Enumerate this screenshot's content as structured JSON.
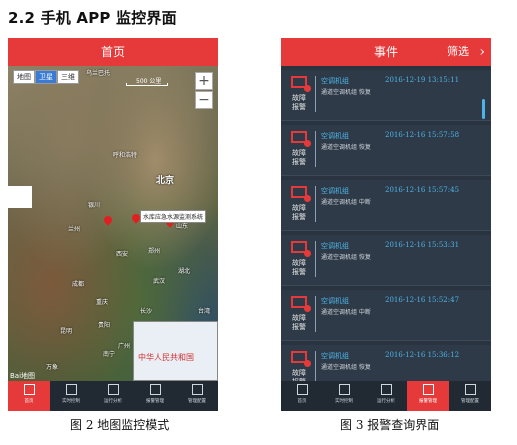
{
  "section_title": "2.2 手机 APP 监控界面",
  "map_screen": {
    "title": "首页",
    "map_types": [
      "地图",
      "卫星",
      "三维"
    ],
    "zoom_in": "+",
    "zoom_out": "−",
    "scale": "500 公里",
    "cities": [
      "乌兰巴托",
      "呼和浩特",
      "北京",
      "银川",
      "兰州",
      "西安",
      "郑州",
      "成都",
      "重庆",
      "武汉",
      "长沙",
      "贵阳",
      "昆明",
      "南宁",
      "广州",
      "台湾",
      "万象",
      "山东",
      "湖北"
    ],
    "station_tooltip": "水库应急水源监测系统",
    "inset_label": "中华人民共和国",
    "baidu_logo": "Bai地图"
  },
  "alarm_screen": {
    "title": "事件",
    "filter_label": "筛选",
    "alarms": [
      {
        "fault": "故障报警",
        "device": "空调机组",
        "time": "2016-12-19 13:15:11",
        "desc": "通道空调机组 恢复"
      },
      {
        "fault": "故障报警",
        "device": "空调机组",
        "time": "2016-12-16 15:57:58",
        "desc": "通道空调机组 恢复"
      },
      {
        "fault": "故障报警",
        "device": "空调机组",
        "time": "2016-12-16 15:57:45",
        "desc": "通道空调机组 中断"
      },
      {
        "fault": "故障报警",
        "device": "空调机组",
        "time": "2016-12-16 15:53:31",
        "desc": "通道空调机组 恢复"
      },
      {
        "fault": "故障报警",
        "device": "空调机组",
        "time": "2016-12-16 15:52:47",
        "desc": "通道空调机组 中断"
      },
      {
        "fault": "故障报警",
        "device": "空调机组",
        "time": "2016-12-16 15:36:12",
        "desc": "通道空调机组 恢复"
      }
    ]
  },
  "nav": [
    "首页",
    "实时控制",
    "运行分析",
    "报警管理",
    "管理配置"
  ],
  "captions": {
    "fig2": "图 2  地图监控模式",
    "fig3": "图 3  报警查询界面"
  }
}
